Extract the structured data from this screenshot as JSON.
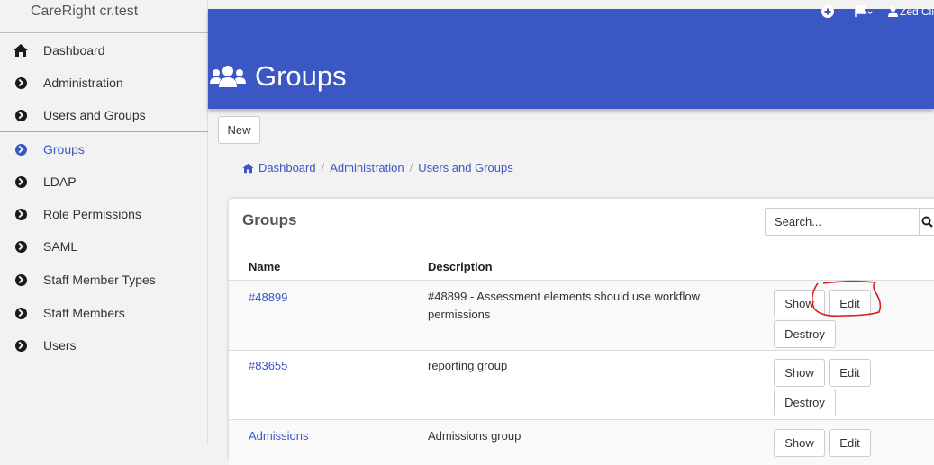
{
  "brand": "CareRight cr.test",
  "sidebar": {
    "items": [
      {
        "label": "Dashboard",
        "icon": "home-icon"
      },
      {
        "label": "Administration",
        "icon": "chevron-circle-right-icon"
      },
      {
        "label": "Users and Groups",
        "icon": "chevron-circle-right-icon"
      },
      {
        "label": "Groups",
        "icon": "chevron-circle-right-icon",
        "active": true
      },
      {
        "label": "LDAP",
        "icon": "chevron-circle-right-icon"
      },
      {
        "label": "Role Permissions",
        "icon": "chevron-circle-right-icon"
      },
      {
        "label": "SAML",
        "icon": "chevron-circle-right-icon"
      },
      {
        "label": "Staff Member Types",
        "icon": "chevron-circle-right-icon"
      },
      {
        "label": "Staff Members",
        "icon": "chevron-circle-right-icon"
      },
      {
        "label": "Users",
        "icon": "chevron-circle-right-icon"
      }
    ]
  },
  "header": {
    "title": "Groups",
    "user": "Zed Cli",
    "colors": {
      "accent": "#3a57c4"
    }
  },
  "toolbar": {
    "new_label": "New"
  },
  "breadcrumb": [
    "Dashboard",
    "Administration",
    "Users and Groups"
  ],
  "card": {
    "title": "Groups",
    "search_placeholder": "Search...",
    "columns": [
      "Name",
      "Description"
    ],
    "rows": [
      {
        "name": "#48899",
        "description": "#48899 - Assessment elements should use workflow permissions",
        "actions": [
          "Show",
          "Edit",
          "Destroy"
        ]
      },
      {
        "name": "#83655",
        "description": "reporting group",
        "actions": [
          "Show",
          "Edit",
          "Destroy"
        ]
      },
      {
        "name": "Admissions",
        "description": "Admissions group",
        "actions": [
          "Show",
          "Edit"
        ]
      }
    ]
  }
}
